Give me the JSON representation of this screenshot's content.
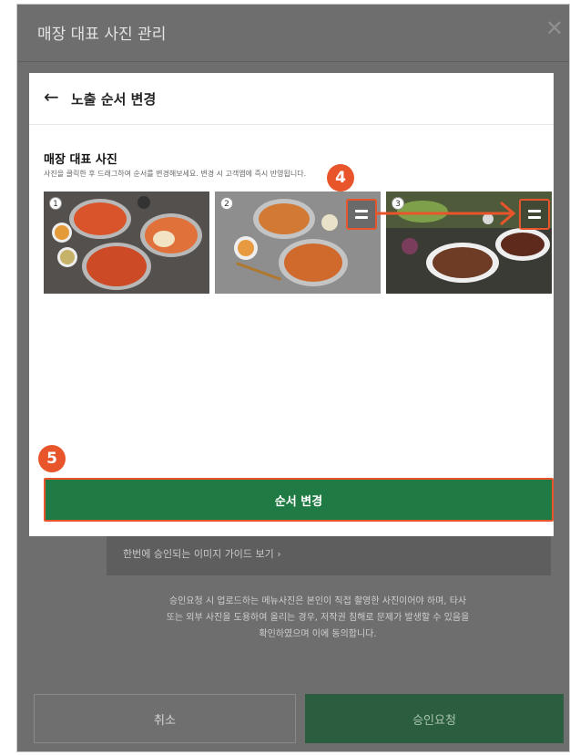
{
  "page": {
    "title": "매장 대표 사진 관리",
    "guide_link": "한번에 승인되는 이미지 가이드 보기 ›",
    "notice_lines": [
      "승인요청 시 업로드하는 메뉴사진은 본인이 직접 촬영한 사진이어야 하며, 타사",
      "또는 외부 사진을 도용하여 올리는 경우, 저작권 침해로 문제가 발생할 수 있음을",
      "확인하였으며 이에 동의합니다."
    ],
    "cancel_label": "취소",
    "approve_label": "승인요청"
  },
  "modal": {
    "title": "노출 순서 변경",
    "section_title": "매장 대표 사진",
    "section_desc": "사진을 클릭한 후 드래그하여 순서를 변경해보세요. 변경 시 고객앱에 즉시 반영됩니다.",
    "photos": [
      {
        "index": "1"
      },
      {
        "index": "2"
      },
      {
        "index": "3"
      }
    ],
    "apply_label": "순서 변경"
  },
  "annotations": {
    "step4": "4",
    "step5": "5",
    "color": "#e8552a"
  },
  "icons": {
    "back": "left-arrow-icon",
    "close": "close-icon",
    "drag": "drag-handle-icon"
  }
}
